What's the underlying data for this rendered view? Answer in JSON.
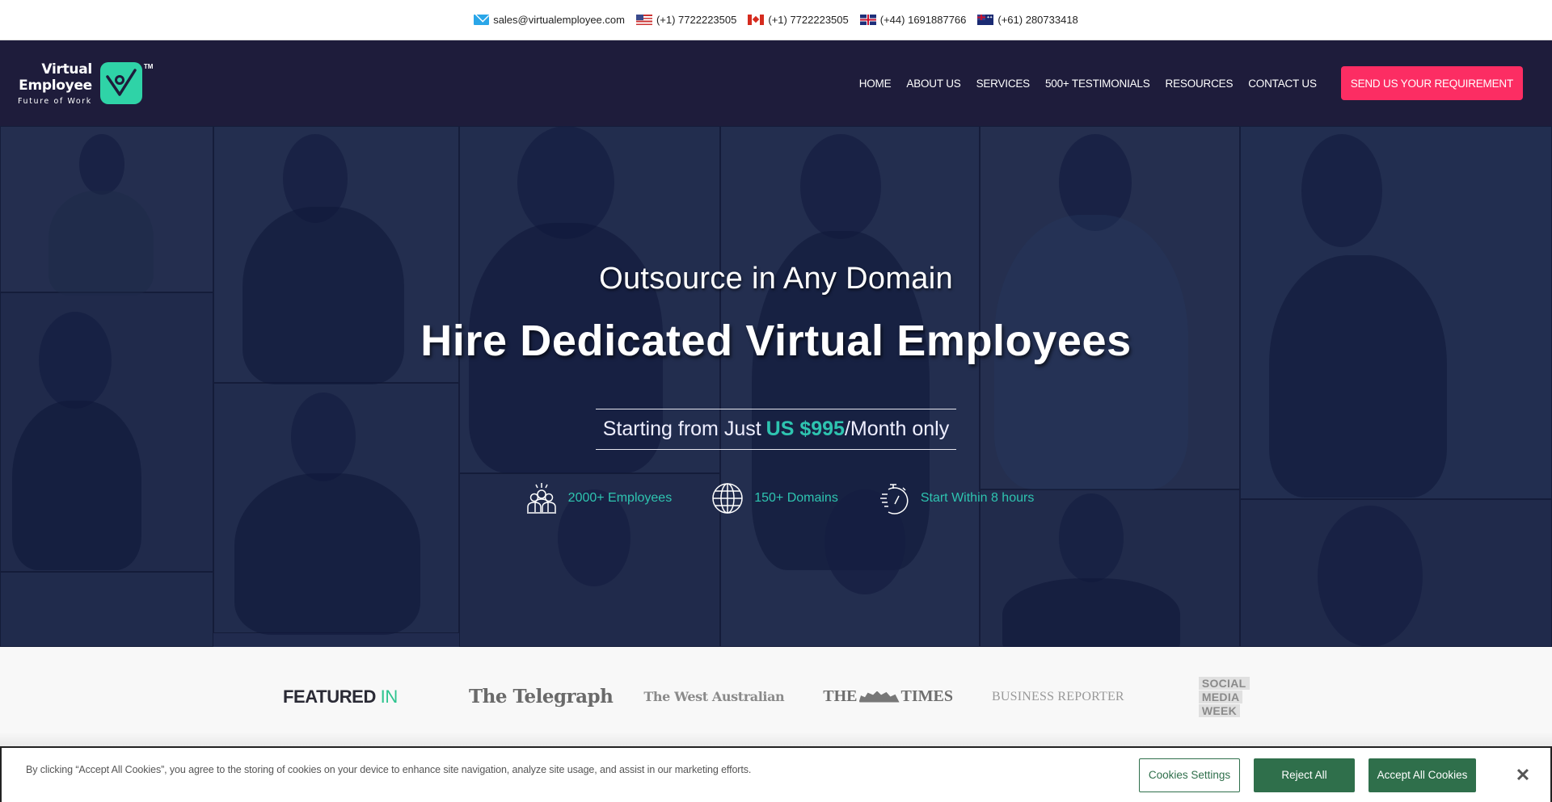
{
  "topbar": {
    "email": "sales@virtualemployee.com",
    "phones": [
      {
        "country": "US",
        "number": "(+1) 7722223505"
      },
      {
        "country": "CA",
        "number": "(+1) 7722223505"
      },
      {
        "country": "UK",
        "number": "(+44) 1691887766"
      },
      {
        "country": "AU",
        "number": "(+61) 280733418"
      }
    ]
  },
  "logo": {
    "line1": "Virtual",
    "line2": "Employee",
    "tagline": "Future of Work",
    "tm": "TM"
  },
  "nav": {
    "items": [
      "HOME",
      "ABOUT US",
      "SERVICES",
      "500+ TESTIMONIALS",
      "RESOURCES",
      "CONTACT US"
    ],
    "cta": "SEND US YOUR REQUIREMENT"
  },
  "hero": {
    "subtitle": "Outsource in Any Domain",
    "title": "Hire Dedicated Virtual Employees",
    "price_prefix": "Starting from Just",
    "price_value": "US $995",
    "price_suffix": "/Month only",
    "stats": [
      {
        "icon": "team-icon",
        "label": "2000+ Employees"
      },
      {
        "icon": "globe-icon",
        "label": "150+ Domains"
      },
      {
        "icon": "stopwatch-icon",
        "label": "Start Within 8 hours"
      }
    ]
  },
  "featured": {
    "title": "FEATURED",
    "title_accent": "IN",
    "logos": [
      "The Telegraph",
      "The West Australian",
      "THE",
      "TIMES",
      "BUSINESS REPORTER",
      "SOCIAL",
      "MEDIA",
      "WEEK"
    ]
  },
  "cookie": {
    "text": "By clicking “Accept All Cookies”, you agree to the storing of cookies on your device to enhance site navigation, analyze site usage, and assist in our marketing efforts.",
    "settings": "Cookies Settings",
    "reject": "Reject All",
    "accept": "Accept All Cookies",
    "close": "✕"
  },
  "colors": {
    "nav_bg": "#1e1c3b",
    "cta": "#fc2d63",
    "accent_teal": "#2ec4b0",
    "logo_green": "#2fd3a7",
    "cookie_green": "#2f6f4b"
  }
}
